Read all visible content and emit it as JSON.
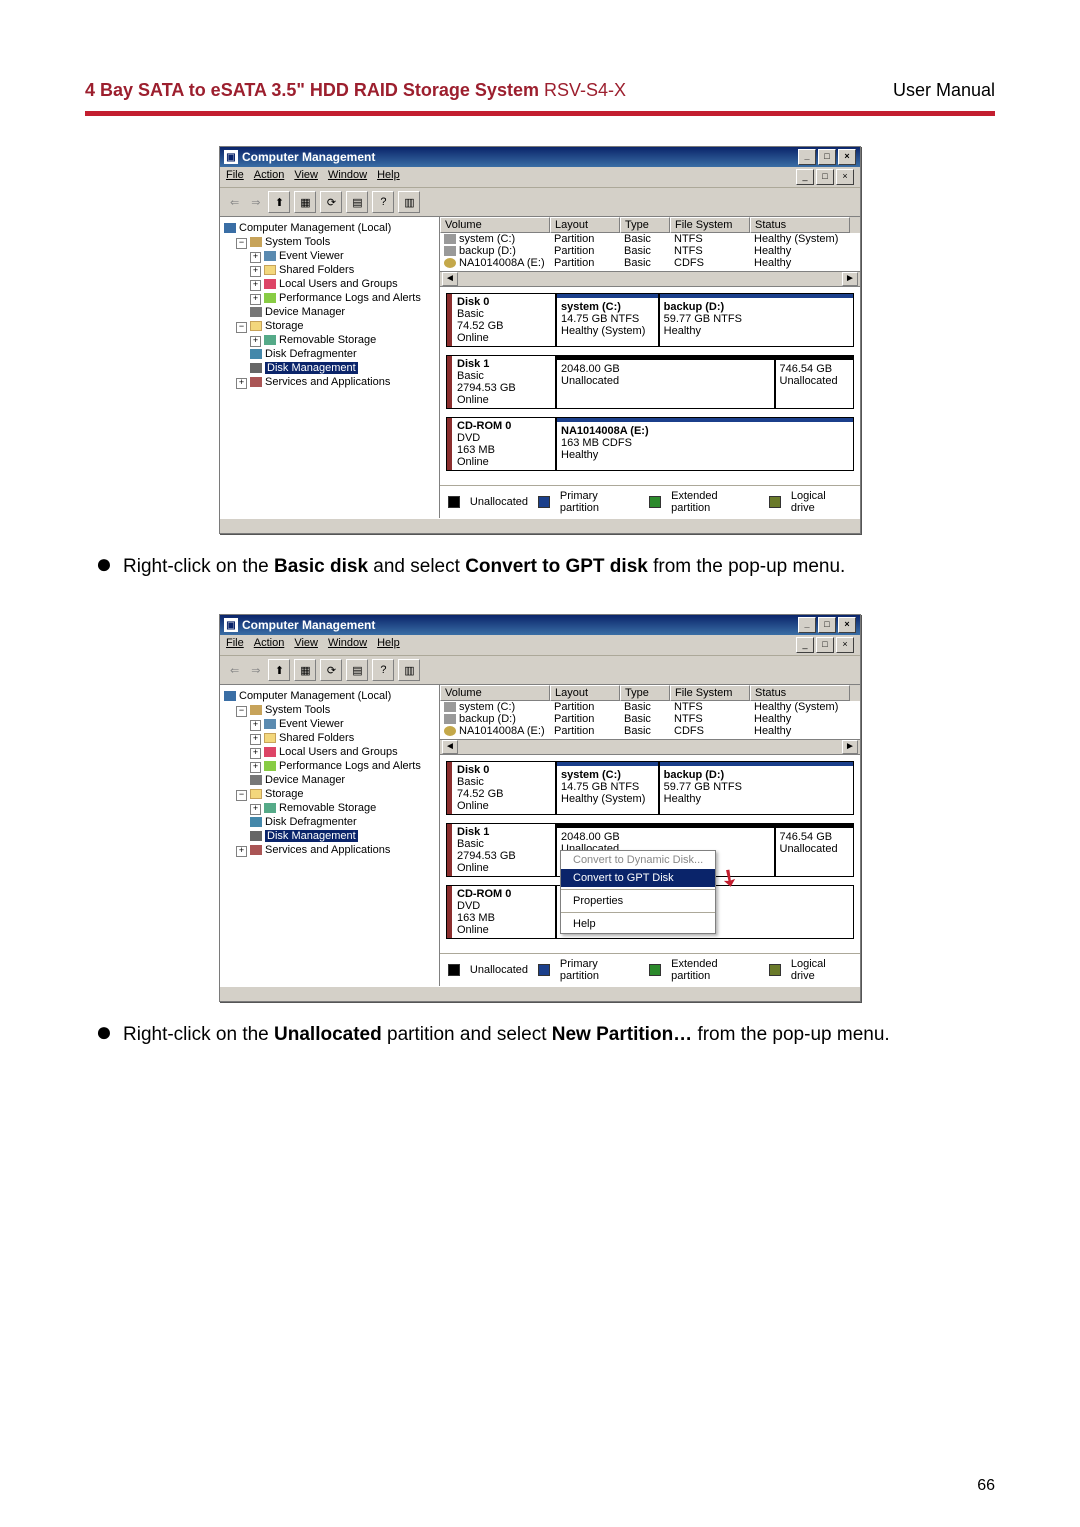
{
  "header": {
    "title_bold": "4 Bay SATA to eSATA 3.5\" HDD RAID Storage System",
    "title_model": " RSV-S4-X",
    "right": "User Manual"
  },
  "bullets": {
    "b1_pre": "Right-click on the ",
    "b1_bold1": "Basic disk",
    "b1_mid": " and select ",
    "b1_bold2": "Convert to GPT disk",
    "b1_post": " from the pop-up menu.",
    "b2_pre": "Right-click on the ",
    "b2_bold1": "Unallocated",
    "b2_mid": " partition and select ",
    "b2_bold2": "New Partition…",
    "b2_post": " from the pop-up menu."
  },
  "mmc": {
    "title": "Computer Management",
    "menu": {
      "file": "File",
      "action": "Action",
      "view": "View",
      "window": "Window",
      "help": "Help"
    },
    "winbtn": {
      "min": "_",
      "max": "□",
      "close": "×"
    },
    "tree": {
      "root": "Computer Management (Local)",
      "systools": "System Tools",
      "ev": "Event Viewer",
      "shared": "Shared Folders",
      "users": "Local Users and Groups",
      "perf": "Performance Logs and Alerts",
      "devmgr": "Device Manager",
      "storage": "Storage",
      "remov": "Removable Storage",
      "defrag": "Disk Defragmenter",
      "diskmgmt": "Disk Management",
      "serv": "Services and Applications"
    },
    "cols": {
      "volume": "Volume",
      "layout": "Layout",
      "type": "Type",
      "fs": "File System",
      "status": "Status"
    },
    "vols": [
      {
        "name": "system (C:)",
        "layout": "Partition",
        "type": "Basic",
        "fs": "NTFS",
        "status": "Healthy (System)",
        "icon": "hdd"
      },
      {
        "name": "backup (D:)",
        "layout": "Partition",
        "type": "Basic",
        "fs": "NTFS",
        "status": "Healthy",
        "icon": "hdd"
      },
      {
        "name": "NA1014008A (E:)",
        "layout": "Partition",
        "type": "Basic",
        "fs": "CDFS",
        "status": "Healthy",
        "icon": "cd"
      }
    ],
    "disks": {
      "d0": {
        "title": "Disk 0",
        "kind": "Basic",
        "size": "74.52 GB",
        "state": "Online",
        "p1_name": "system (C:)",
        "p1_size": "14.75 GB NTFS",
        "p1_state": "Healthy (System)",
        "p2_name": "backup (D:)",
        "p2_size": "59.77 GB NTFS",
        "p2_state": "Healthy"
      },
      "d1": {
        "title": "Disk 1",
        "kind": "Basic",
        "size": "2794.53 GB",
        "state": "Online",
        "p1_size": "2048.00 GB",
        "p1_state": "Unallocated",
        "p2_size": "746.54 GB",
        "p2_state": "Unallocated"
      },
      "cd": {
        "title": "CD-ROM 0",
        "kind": "DVD",
        "size": "163 MB",
        "state": "Online",
        "p1_name": "NA1014008A (E:)",
        "p1_size": "163 MB CDFS",
        "p1_state": "Healthy"
      }
    },
    "legend": {
      "unalloc": "Unallocated",
      "primary": "Primary partition",
      "ext": "Extended partition",
      "logical": "Logical drive"
    },
    "scroll": {
      "left": "◄",
      "right": "►"
    }
  },
  "ctx": {
    "dyn": "Convert to Dynamic Disk...",
    "gpt": "Convert to GPT Disk",
    "prop": "Properties",
    "help": "Help"
  },
  "page_number": "66"
}
